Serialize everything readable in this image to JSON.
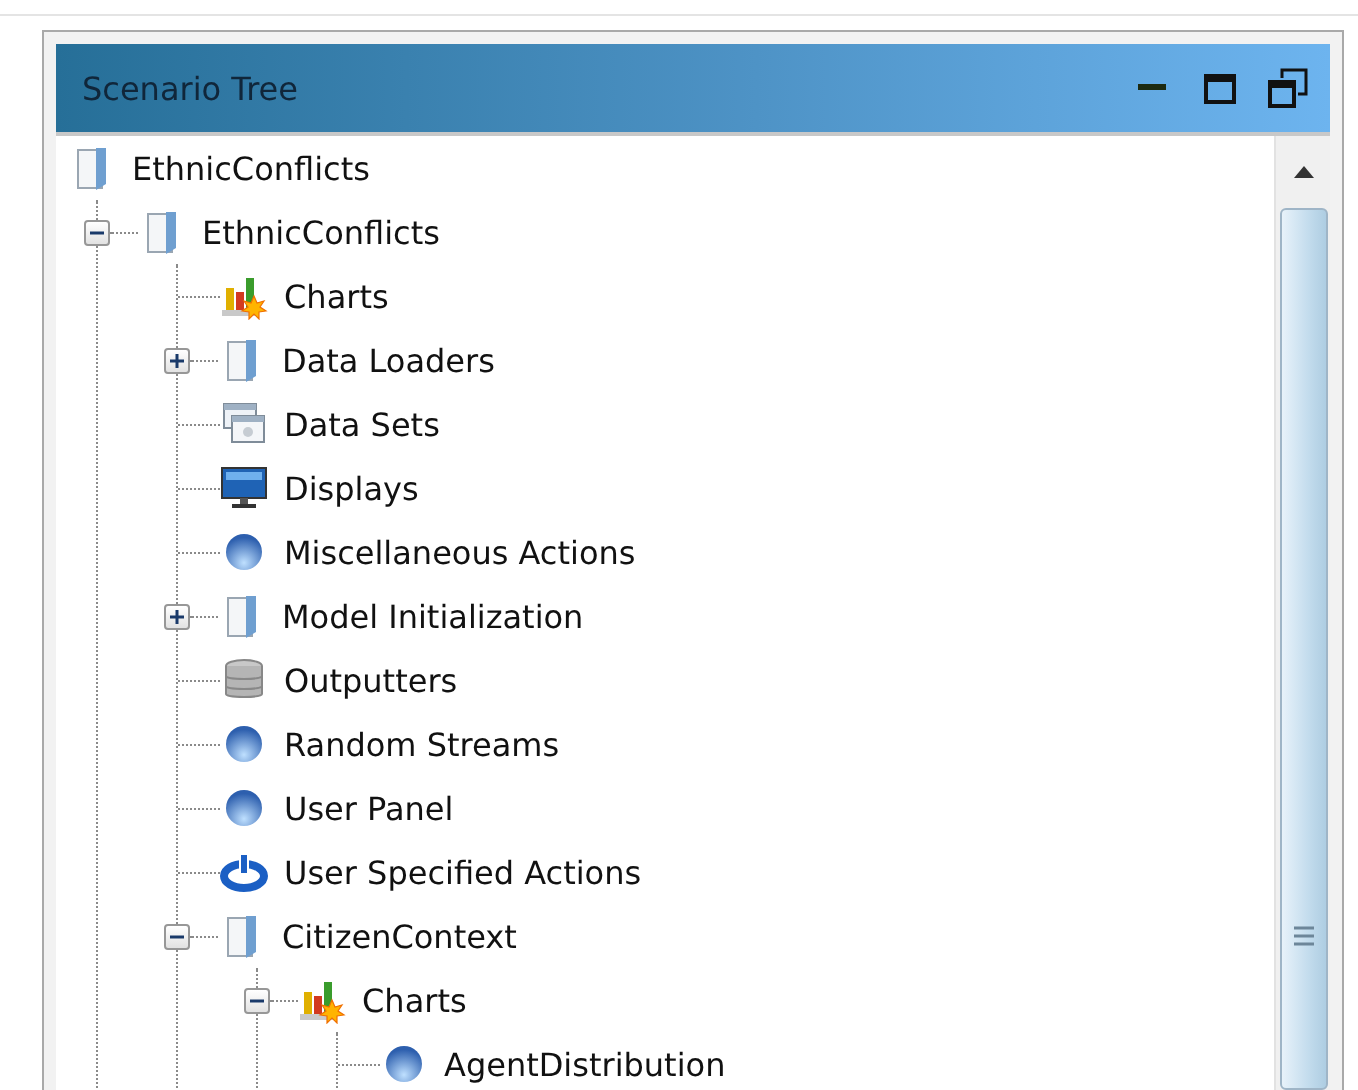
{
  "panel": {
    "title": "Scenario Tree"
  },
  "tree": [
    {
      "label": "EthnicConflicts",
      "kind": "folder",
      "children": [
        {
          "label": "EthnicConflicts",
          "kind": "folder",
          "expanded": true,
          "children": [
            {
              "label": "Charts",
              "kind": "chart"
            },
            {
              "label": "Data Loaders",
              "kind": "folder",
              "expanded": false
            },
            {
              "label": "Data Sets",
              "kind": "dataset"
            },
            {
              "label": "Displays",
              "kind": "display"
            },
            {
              "label": "Miscellaneous Actions",
              "kind": "sphere"
            },
            {
              "label": "Model Initialization",
              "kind": "folder",
              "expanded": false
            },
            {
              "label": "Outputters",
              "kind": "database"
            },
            {
              "label": "Random Streams",
              "kind": "sphere"
            },
            {
              "label": "User Panel",
              "kind": "sphere"
            },
            {
              "label": "User Specified Actions",
              "kind": "power"
            },
            {
              "label": "CitizenContext",
              "kind": "folder",
              "expanded": true,
              "children": [
                {
                  "label": "Charts",
                  "kind": "chart",
                  "expanded": true,
                  "children": [
                    {
                      "label": "AgentDistribution",
                      "kind": "sphere"
                    }
                  ]
                }
              ]
            }
          ]
        }
      ]
    }
  ]
}
